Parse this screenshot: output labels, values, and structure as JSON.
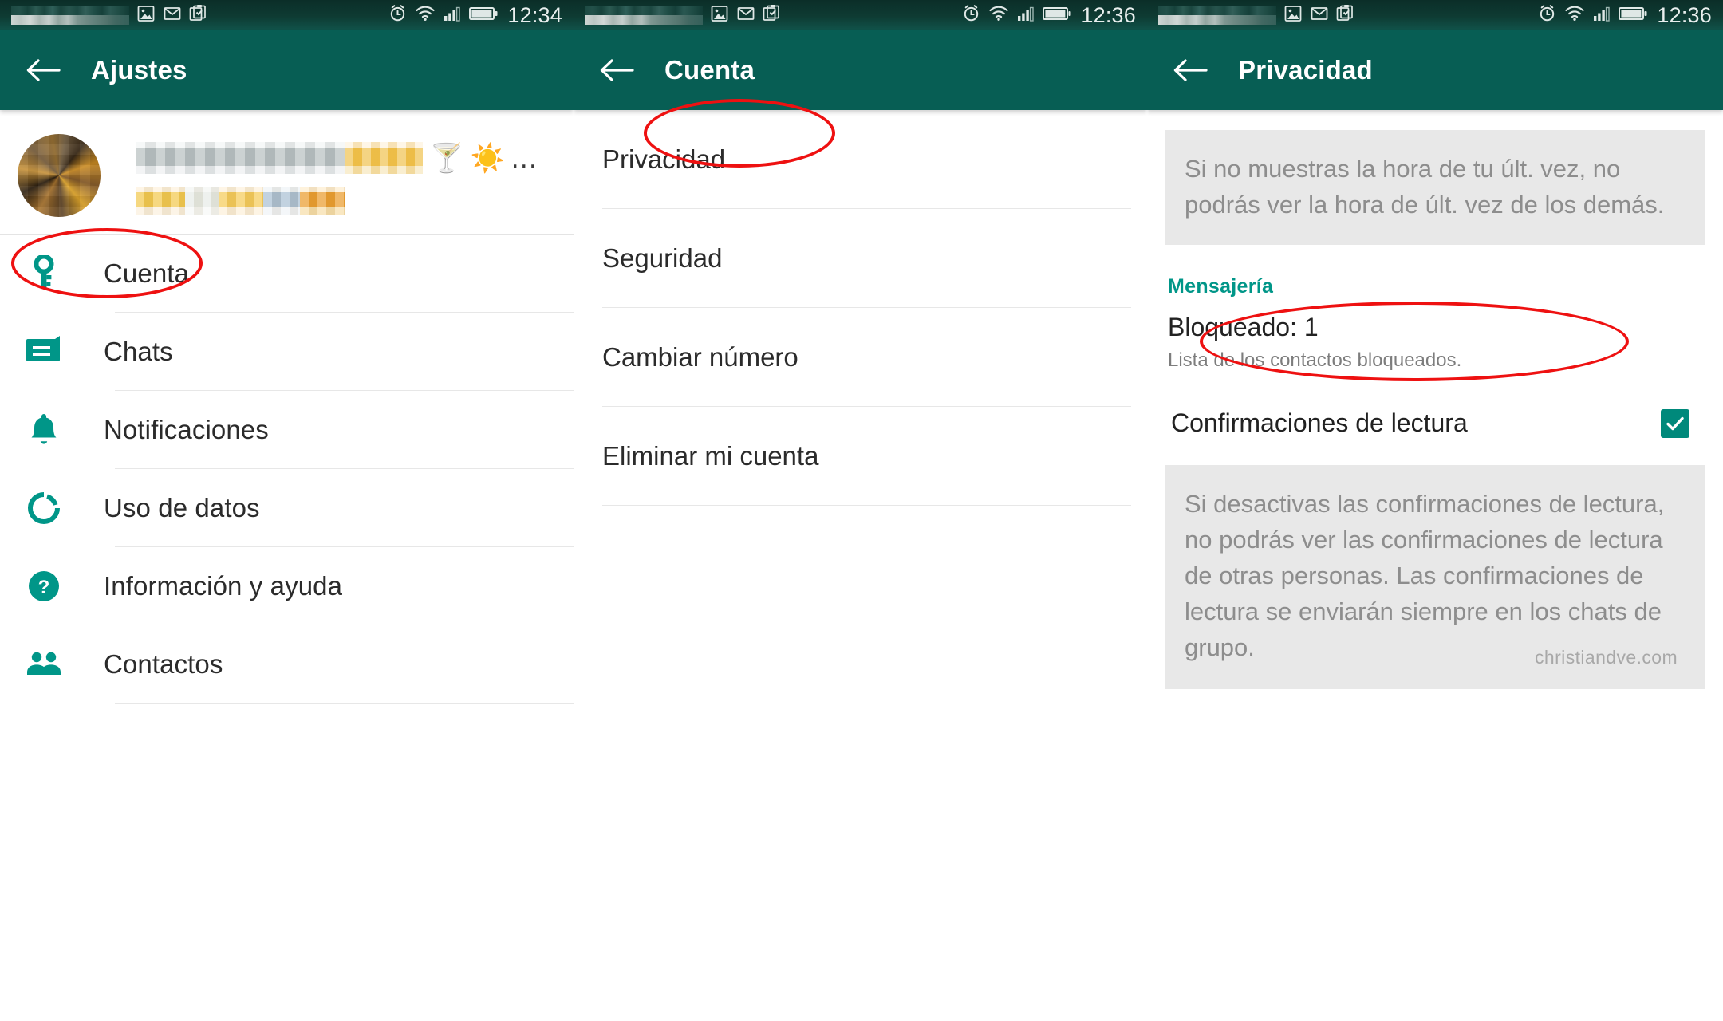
{
  "screens": {
    "settings": {
      "statusbar": {
        "icons": [
          "image-icon",
          "mail-icon",
          "clipboard-check-icon",
          "alarm-icon",
          "wifi-icon",
          "signal-icon",
          "battery-icon"
        ],
        "time": "12:34"
      },
      "appbar": {
        "title": "Ajustes",
        "back": "back-arrow"
      },
      "profile": {
        "name_redacted": true,
        "emoji_cocktail": "🍸",
        "emoji_sun": "☀️",
        "ellipsis": "…"
      },
      "items": [
        {
          "label": "Cuenta",
          "icon": "key-icon"
        },
        {
          "label": "Chats",
          "icon": "chat-bubble-icon"
        },
        {
          "label": "Notificaciones",
          "icon": "bell-icon"
        },
        {
          "label": "Uso de datos",
          "icon": "data-usage-icon"
        },
        {
          "label": "Información y ayuda",
          "icon": "help-circle-icon"
        },
        {
          "label": "Contactos",
          "icon": "contacts-icon"
        }
      ]
    },
    "account": {
      "statusbar": {
        "time": "12:36"
      },
      "appbar": {
        "title": "Cuenta",
        "back": "back-arrow"
      },
      "items": [
        {
          "label": "Privacidad"
        },
        {
          "label": "Seguridad"
        },
        {
          "label": "Cambiar número"
        },
        {
          "label": "Eliminar mi cuenta"
        }
      ]
    },
    "privacy": {
      "statusbar": {
        "time": "12:36"
      },
      "appbar": {
        "title": "Privacidad",
        "back": "back-arrow"
      },
      "info_top": "Si no muestras la hora de tu últ. vez, no podrás ver la hora de últ. vez de los demás.",
      "section_messaging": "Mensajería",
      "blocked": {
        "title": "Bloqueado: 1",
        "subtitle": "Lista de los contactos bloqueados."
      },
      "read_receipts": {
        "label": "Confirmaciones de lectura",
        "checked": true
      },
      "info_bottom": "Si desactivas las confirmaciones de lectura, no podrás ver las confirmaciones de lectura de otras personas. Las confirmaciones de lectura se enviarán siempre en los chats de grupo.",
      "watermark": "christiandve.com"
    }
  },
  "annotations": {
    "highlight_cuenta": "Cuenta",
    "highlight_privacidad": "Privacidad",
    "highlight_bloqueado": "Bloqueado: 1"
  },
  "colors": {
    "appbar_green": "#075e54",
    "accent_teal": "#009688",
    "annotation_red": "#ee1111",
    "info_bg": "#e8e8e8"
  }
}
